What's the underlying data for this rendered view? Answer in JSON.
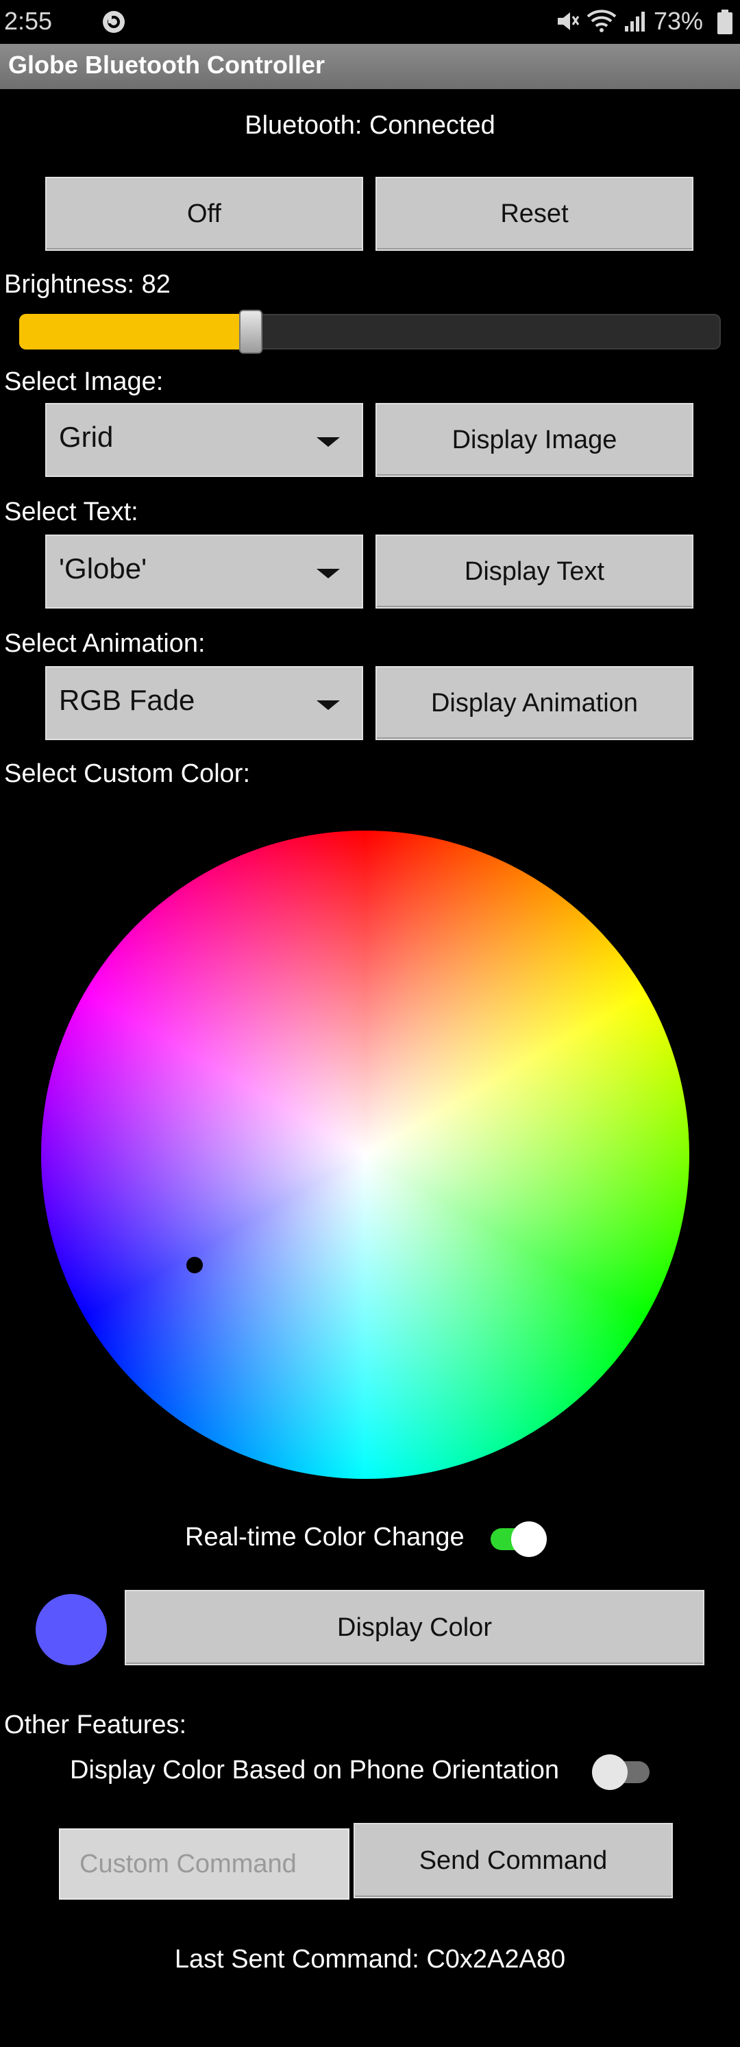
{
  "status_bar": {
    "time": "2:55",
    "battery": "73%",
    "icons": [
      "beats-icon",
      "mute-icon",
      "wifi-icon",
      "signal-icon",
      "battery-icon"
    ]
  },
  "app": {
    "title": "Globe Bluetooth Controller"
  },
  "bluetooth": {
    "status": "Bluetooth: Connected"
  },
  "controls": {
    "off_label": "Off",
    "reset_label": "Reset"
  },
  "brightness": {
    "label": "Brightness: 82",
    "value_fraction": 0.33,
    "fill_color": "#f8c200"
  },
  "image": {
    "label": "Select Image:",
    "selected": "Grid",
    "button": "Display Image"
  },
  "text": {
    "label": "Select Text:",
    "selected": "'Globe'",
    "button": "Display Text"
  },
  "animation": {
    "label": "Select Animation:",
    "selected": "RGB Fade",
    "button": "Display Animation"
  },
  "custom_color": {
    "label": "Select Custom Color:",
    "realtime_label": "Real-time Color Change",
    "realtime_on": true,
    "swatch_color": "#5a57ff",
    "display_button": "Display Color"
  },
  "other": {
    "label": "Other Features:",
    "orientation_label": "Display Color Based on Phone Orientation",
    "orientation_on": false,
    "command_placeholder": "Custom Command",
    "send_button": "Send Command",
    "last_sent": "Last Sent Command: C0x2A2A80"
  },
  "colors": {
    "toggle_on_track": "#2fd82f",
    "toggle_off_track": "#6e6e6e"
  }
}
